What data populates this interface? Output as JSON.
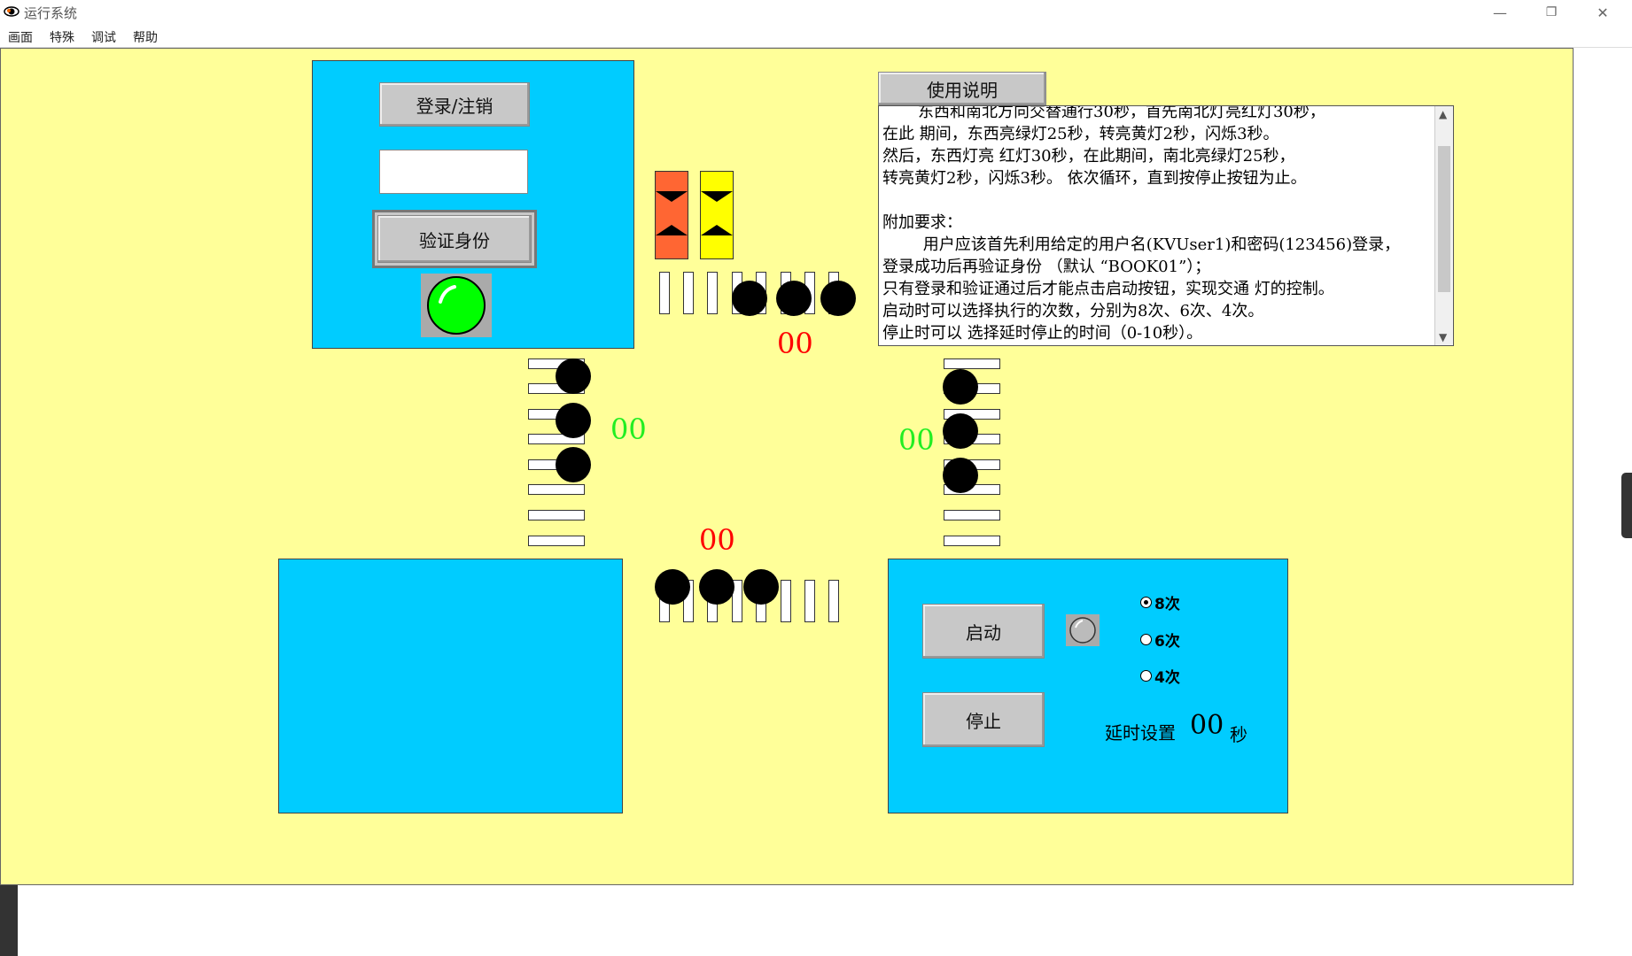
{
  "window": {
    "title": "运行系统",
    "minimize": "—",
    "restore": "❐",
    "close": "✕"
  },
  "menu": [
    "画面",
    "特殊",
    "调试",
    "帮助"
  ],
  "login_panel": {
    "login_button": "登录/注销",
    "input_value": "",
    "verify_button": "验证身份",
    "status_light_color": "#00ff00"
  },
  "help": {
    "button": "使用说明",
    "text": "       东西和南北方向交替通行30秒，首先南北灯亮红灯30秒，\n在此 期间，东西亮绿灯25秒，转亮黄灯2秒，闪烁3秒。\n然后，东西灯亮 红灯30秒，在此期间，南北亮绿灯25秒，\n转亮黄灯2秒，闪烁3秒。 依次循环，直到按停止按钮为止。\n\n附加要求：\n        用户应该首先利用给定的用户名(KVUser1)和密码(123456)登录，\n登录成功后再验证身份 （默认 “BOOK01”）；\n只有登录和验证通过后才能点击启动按钮，实现交通 灯的控制。\n启动时可以选择执行的次数，分别为8次、6次、4次。\n停止时可以 选择延时停止的时间（0-10秒）。"
  },
  "counters": {
    "north": "00",
    "west": "00",
    "east": "00",
    "south": "00"
  },
  "control_panel": {
    "start_button": "启动",
    "stop_button": "停止",
    "radios": [
      {
        "label": "8次",
        "selected": true
      },
      {
        "label": "6次",
        "selected": false
      },
      {
        "label": "4次",
        "selected": false
      }
    ],
    "delay_label": "延时设置",
    "delay_value": "00",
    "delay_unit": "秒"
  },
  "colors": {
    "canvas": "#ffff99",
    "panel": "#00ccff",
    "red_light": "#ff6633",
    "yellow_light": "#ffff00"
  }
}
